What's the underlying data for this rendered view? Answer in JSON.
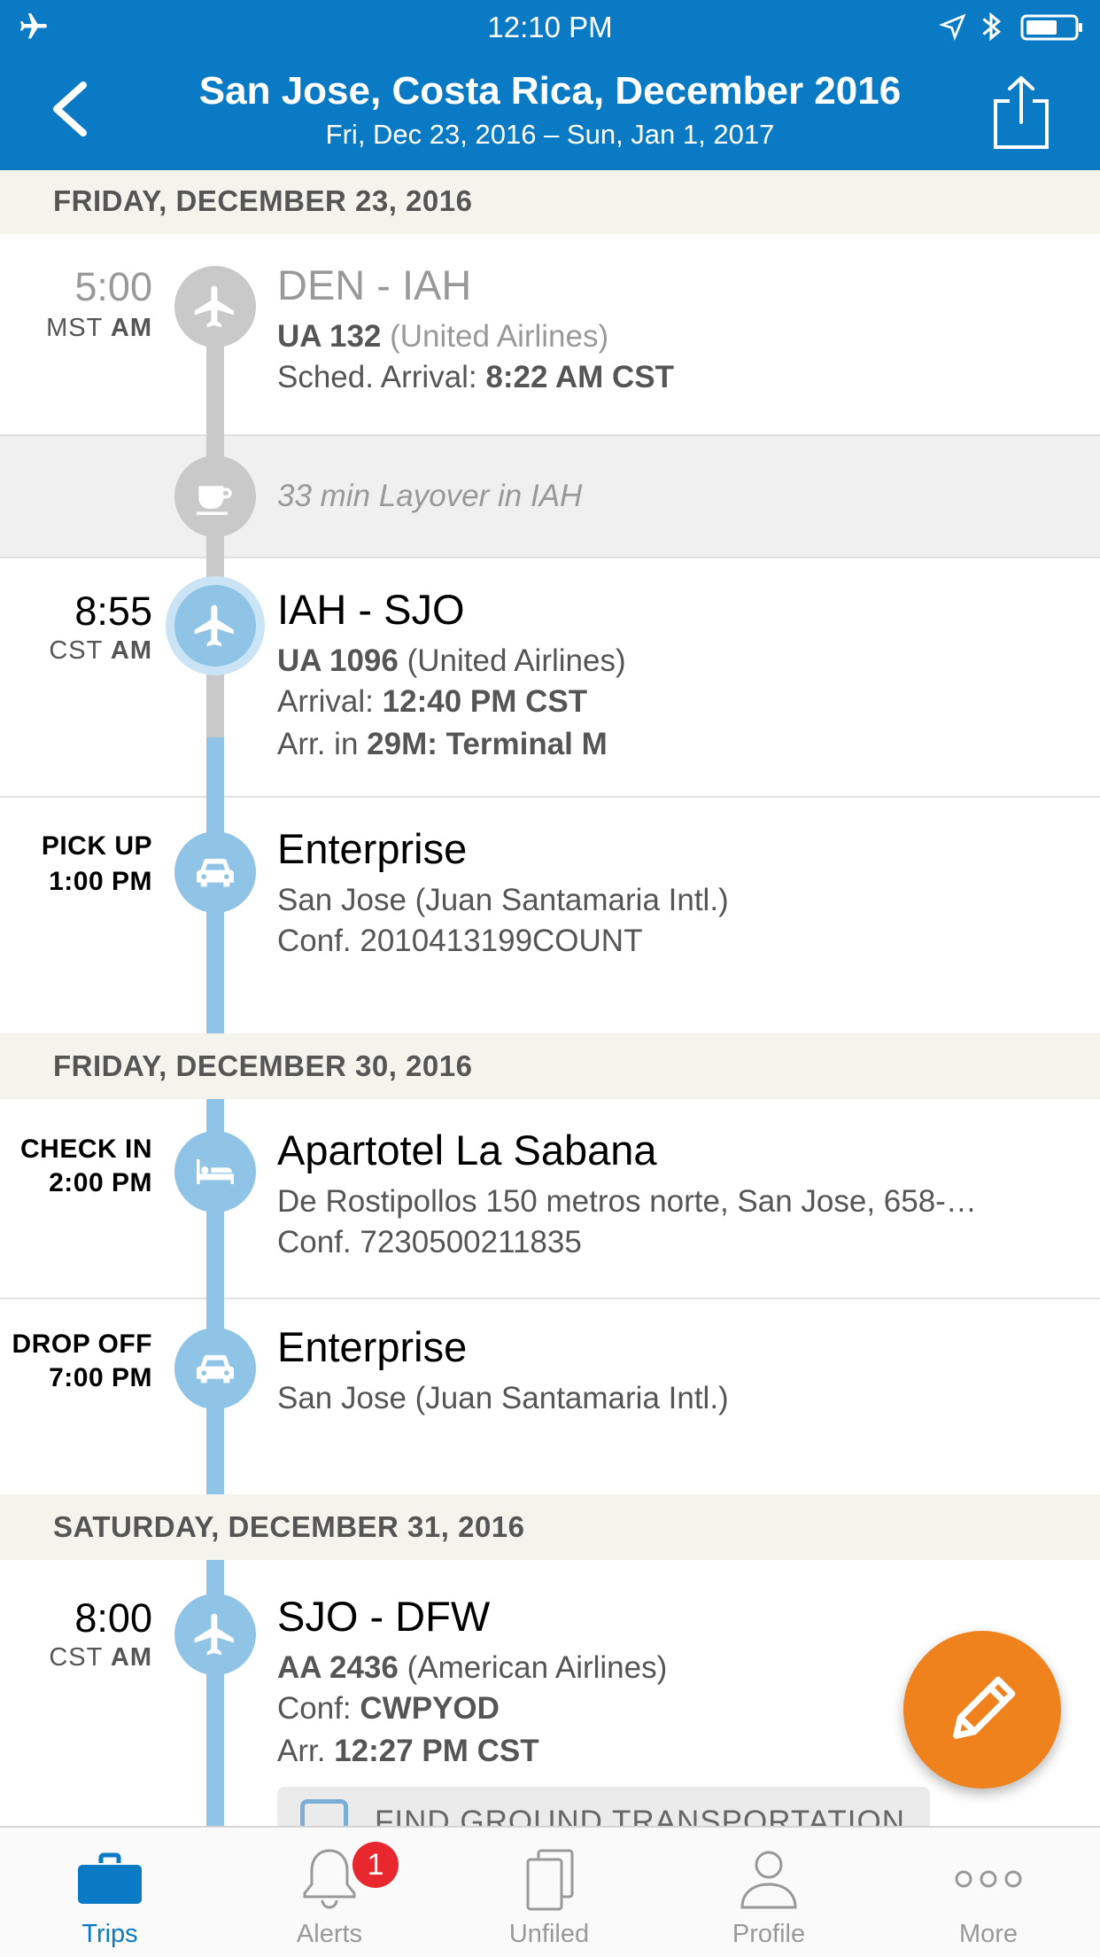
{
  "status_bar": {
    "time": "12:10 PM"
  },
  "header": {
    "title": "San Jose, Costa Rica, December 2016",
    "dates": "Fri, Dec 23, 2016 – Sun, Jan 1, 2017"
  },
  "days": [
    {
      "label": "FRIDAY, DECEMBER 23, 2016"
    },
    {
      "label": "FRIDAY, DECEMBER 30, 2016"
    },
    {
      "label": "SATURDAY, DECEMBER 31, 2016"
    }
  ],
  "flight1": {
    "time": "5:00",
    "tz": "MST",
    "ampm": "AM",
    "route": "DEN - IAH",
    "flight_no": "UA 132",
    "airline": "(United Airlines)",
    "arrival_label": "Sched. Arrival:",
    "arrival": "8:22 AM CST",
    "status": "past"
  },
  "layover": {
    "text": "33 min Layover in IAH"
  },
  "flight2": {
    "time": "8:55",
    "tz": "CST",
    "ampm": "AM",
    "route": "IAH - SJO",
    "flight_no": "UA 1096",
    "airline": "(United Airlines)",
    "arrival_label": "Arrival:",
    "arrival": "12:40 PM CST",
    "arr_in_label": "Arr. in",
    "arr_in": "29M: Terminal M"
  },
  "car_pickup": {
    "action": "PICK UP",
    "time": "1:00 PM",
    "name": "Enterprise",
    "location": "San Jose (Juan Santamaria Intl.)",
    "conf": "Conf. 2010413199COUNT"
  },
  "hotel": {
    "action": "CHECK IN",
    "time": "2:00 PM",
    "name": "Apartotel La Sabana",
    "address": "De Rostipollos 150 metros norte, San Jose, 658-…",
    "conf": "Conf. 7230500211835"
  },
  "car_dropoff": {
    "action": "DROP OFF",
    "time": "7:00 PM",
    "name": "Enterprise",
    "location": "San Jose (Juan Santamaria Intl.)"
  },
  "flight3": {
    "time": "8:00",
    "tz": "CST",
    "ampm": "AM",
    "route": "SJO - DFW",
    "flight_no": "AA 2436",
    "airline": "(American Airlines)",
    "conf_label": "Conf:",
    "conf": "CWPYOD",
    "arrival_label": "Arr.",
    "arrival": "12:27 PM CST",
    "ground_button": "FIND GROUND TRANSPORTATION"
  },
  "fab": {
    "icon": "pencil-icon"
  },
  "tabs": [
    {
      "label": "Trips",
      "icon": "briefcase-icon",
      "active": true
    },
    {
      "label": "Alerts",
      "icon": "bell-icon",
      "badge": "1"
    },
    {
      "label": "Unfiled",
      "icon": "documents-icon"
    },
    {
      "label": "Profile",
      "icon": "person-icon"
    },
    {
      "label": "More",
      "icon": "ellipsis-icon"
    }
  ],
  "colors": {
    "header_bg": "#0a7ac4",
    "timeline_blue": "#8fc4e6",
    "timeline_gray": "#c9c9c9",
    "fab": "#f0821e",
    "badge": "#e8282e",
    "day_header_bg": "#f4f3ec"
  }
}
